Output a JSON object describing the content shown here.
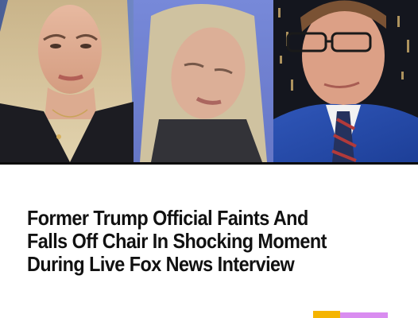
{
  "headline": {
    "lines": [
      "Former Trump Official Faints And",
      "Falls Off Chair In Shocking Moment",
      "During Live Fox News Interview"
    ]
  },
  "photos": {
    "panels": [
      "woman-seated-panel",
      "woman-fainting-panel",
      "man-host-panel"
    ]
  },
  "colors": {
    "background": "#ffffff",
    "headline_text": "#111111",
    "divider": "#0b0b0b",
    "logo_yellow": "#f5b400",
    "logo_pink": "#d98cf0"
  }
}
